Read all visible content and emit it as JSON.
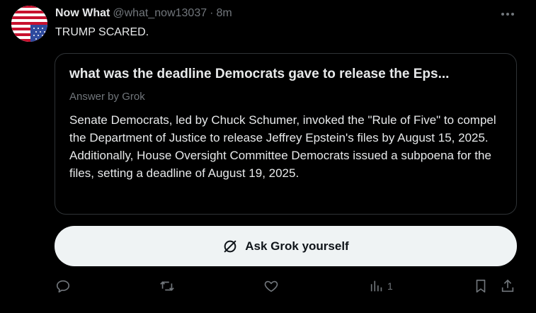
{
  "post": {
    "author_name": "Now What",
    "author_handle": "@what_now13037",
    "separator": "·",
    "time": "8m",
    "text": "TRUMP SCARED."
  },
  "grok_card": {
    "question": "what was the deadline Democrats gave to release the Eps...",
    "subtitle": "Answer by Grok",
    "answer": "Senate Democrats, led by Chuck Schumer, invoked the \"Rule of Five\" to compel the Department of Justice to release Jeffrey Epstein's files by August 15, 2025. Additionally, House Oversight Committee Democrats issued a subpoena for the files, setting a deadline of August 19, 2025."
  },
  "ask_button": {
    "label": "Ask Grok yourself",
    "icon": "grok-icon"
  },
  "actions": {
    "reply_icon": "reply-icon",
    "repost_icon": "repost-icon",
    "like_icon": "like-icon",
    "views_icon": "views-icon",
    "views_count": "1",
    "bookmark_icon": "bookmark-icon",
    "share_icon": "share-icon"
  },
  "avatar": {
    "description_icon": "us-flag-avatar"
  },
  "colors": {
    "background": "#000000",
    "primary_text": "#e7e9ea",
    "secondary_text": "#71767b",
    "border": "#2f3336",
    "button_bg": "#eff3f4",
    "button_text": "#0f1419"
  }
}
